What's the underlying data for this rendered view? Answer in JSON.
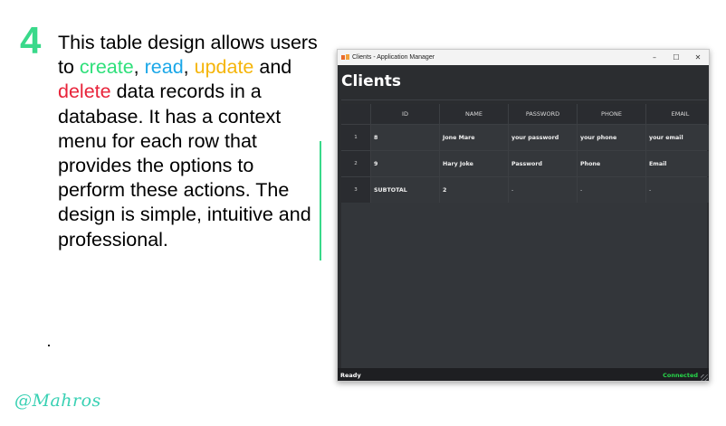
{
  "slide": {
    "step_number": "4",
    "text_parts": [
      {
        "text": "This table design allows users to ",
        "style": "plain"
      },
      {
        "text": "create",
        "style": "create"
      },
      {
        "text": ", ",
        "style": "plain"
      },
      {
        "text": "read",
        "style": "read"
      },
      {
        "text": ", ",
        "style": "plain"
      },
      {
        "text": "update",
        "style": "update"
      },
      {
        "text": " and ",
        "style": "plain"
      },
      {
        "text": "delete",
        "style": "delete"
      },
      {
        "text": " data records in a database. It has a context menu for each row that provides the options to perform these actions. The design is simple, intuitive and professional.",
        "style": "plain"
      }
    ],
    "signature": "@Mahros",
    "colors": {
      "create": "#2ee07a",
      "read": "#1aa7e8",
      "update": "#f5b50a",
      "delete": "#e8233a",
      "accent": "#39d98a"
    }
  },
  "window": {
    "title": "Clients - Application Manager",
    "controls": {
      "minimize": "–",
      "maximize": "☐",
      "close": "✕"
    },
    "heading": "Clients",
    "table": {
      "columns": [
        "ID",
        "NAME",
        "PASSWORD",
        "PHONE",
        "EMAIL"
      ],
      "rows": [
        {
          "row_header": "1",
          "cells": [
            "8",
            "Jone Mare",
            "your password",
            "your phone",
            "your email"
          ]
        },
        {
          "row_header": "2",
          "cells": [
            "9",
            "Hary Joke",
            "Password",
            "Phone",
            "Email"
          ]
        },
        {
          "row_header": "3",
          "cells": [
            "SUBTOTAL",
            "2",
            "-",
            "-",
            "-"
          ]
        }
      ]
    },
    "status": {
      "left": "Ready",
      "right": "Connected"
    }
  }
}
